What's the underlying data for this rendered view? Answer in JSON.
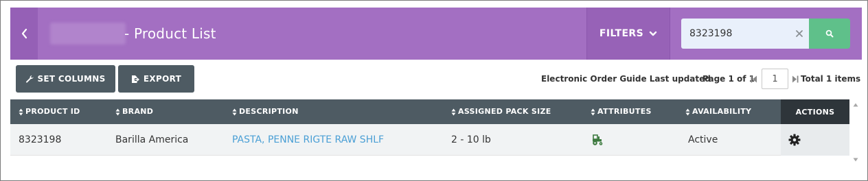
{
  "header": {
    "title": "- Product List",
    "filters_label": "FILTERS",
    "search_value": "8323198"
  },
  "toolbar": {
    "set_columns_label": "SET COLUMNS",
    "export_label": "EXPORT",
    "guide_text": "Electronic Order Guide Last updated",
    "page_text": "Page 1 of 1",
    "page_value": "1",
    "total_text": "Total 1 items"
  },
  "table": {
    "columns": [
      "PRODUCT ID",
      "BRAND",
      "DESCRIPTION",
      "ASSIGNED PACK SIZE",
      "ATTRIBUTES",
      "AVAILABILITY",
      "ACTIONS"
    ],
    "rows": [
      {
        "product_id": "8323198",
        "brand": "Barilla America",
        "description": "PASTA, PENNE RIGTE RAW SHLF",
        "pack_size": "2 - 10 lb",
        "attribute_icon": "tractor-icon",
        "availability": "Active"
      }
    ]
  },
  "colors": {
    "header_bg": "#a36fc2",
    "search_button": "#5fc08a",
    "table_header": "#4e5b63",
    "link": "#4a9fd5",
    "attribute_icon": "#3d7a3f"
  }
}
